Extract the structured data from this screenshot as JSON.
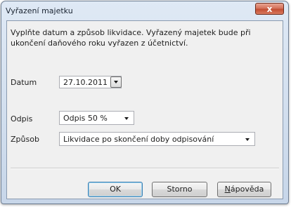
{
  "window": {
    "title": "Vyřazení majetku",
    "close_glyph": "x",
    "close_icon": "close-icon"
  },
  "info_text": "Vyplňte datum a způsob likvidace. Vyřazený majetek bude při ukončení daňového roku vyřazen z účetnictví.",
  "form": {
    "datum_label": "Datum",
    "datum_value": "27.10.2011",
    "odpis_label": "Odpis",
    "odpis_value": "Odpis 50 %",
    "zpusob_label": "Způsob",
    "zpusob_value": "Likvidace po skončení doby odpisování"
  },
  "buttons": {
    "ok": "OK",
    "storno": "Storno",
    "napoveda": "Nápověda"
  },
  "colors": {
    "accent_close": "#c24f34",
    "default_button_border": "#3c7fb1"
  }
}
